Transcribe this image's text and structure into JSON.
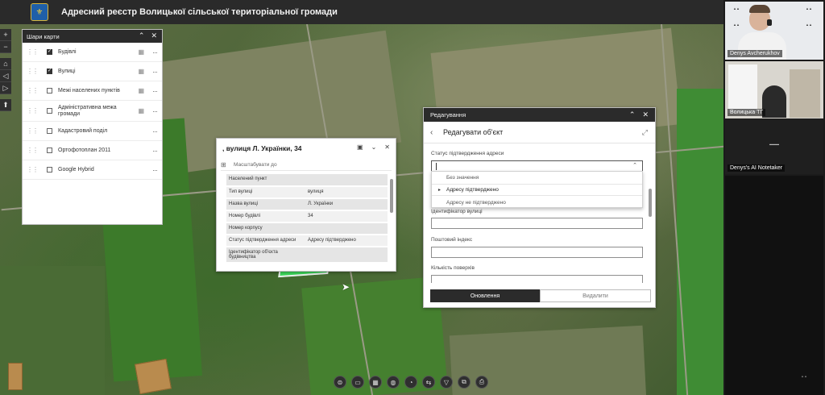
{
  "header": {
    "logo_glyph": "⚜",
    "title": "Адресний реєстр Волицької сільської територіальної громади"
  },
  "left_toolbar": {
    "zoom_in": "+",
    "zoom_out": "−",
    "home": "⌂",
    "prev": "◁",
    "next": "▷",
    "compass": "⬆"
  },
  "layers_panel": {
    "title": "Шари карти",
    "collapse_icon": "⌃",
    "close_icon": "✕",
    "items": [
      {
        "label": "Будівлі",
        "checked": true
      },
      {
        "label": "Вулиці",
        "checked": true
      },
      {
        "label": "Межі населених пунктів",
        "checked": false
      },
      {
        "label": "Адміністративна межа громади",
        "checked": false
      },
      {
        "label": "Кадастровий поділ",
        "checked": false
      },
      {
        "label": "Ортофотоплан 2011",
        "checked": false
      },
      {
        "label": "Google Hybrid",
        "checked": false
      }
    ],
    "more_glyph": "···",
    "table_glyph": "▦",
    "grip_glyph": "⋮⋮"
  },
  "popup": {
    "title": ", вулиця Л. Українки, 34",
    "zoom_label": "Масштабувати до",
    "grid_glyph": "⊞",
    "icons": {
      "dock": "▣",
      "collapse": "⌄",
      "close": "✕"
    },
    "rows": [
      {
        "key": "Населений пункт",
        "value": ""
      },
      {
        "key": "Тип вулиці",
        "value": "вулиця"
      },
      {
        "key": "Назва вулиці",
        "value": "Л. Українки"
      },
      {
        "key": "Номер будівлі",
        "value": "34"
      },
      {
        "key": "Номер корпусу",
        "value": ""
      },
      {
        "key": "Статус підтвердження адреси",
        "value": "Адресу підтверджено"
      },
      {
        "key": "Ідентифікатор об'єкта будівництва",
        "value": ""
      },
      {
        "key": "Ідентифікатор вулиці",
        "value": ""
      }
    ]
  },
  "edit_panel": {
    "title": "Редагування",
    "subtitle": "Редагувати об'єкт",
    "back_glyph": "‹",
    "expand_glyph": "⤢",
    "fields": {
      "status_label": "Статус підтвердження адреси",
      "street_id_label": "Ідентифікатор вулиці",
      "postal_label": "Поштовий індекс",
      "floors_label": "Кількість поверхів"
    },
    "dropdown_options": [
      {
        "label": "Без значення",
        "selected": false
      },
      {
        "label": "Адресу підтверджено",
        "selected": true
      },
      {
        "label": "Адресу не підтверджено",
        "selected": false
      }
    ],
    "selected_mark": "▸",
    "update_button": "Оновлення",
    "delete_button": "Видалити"
  },
  "bottom_toolbar": [
    "⊜",
    "▭",
    "▦",
    "◍",
    "◔",
    "⇆",
    "▽",
    "⧉",
    "⎙"
  ],
  "video_tiles": [
    {
      "name": "Denys Avcherukhov"
    },
    {
      "name": "Волицька ТГ"
    },
    {
      "name": "Denys's AI Notetaker"
    }
  ]
}
